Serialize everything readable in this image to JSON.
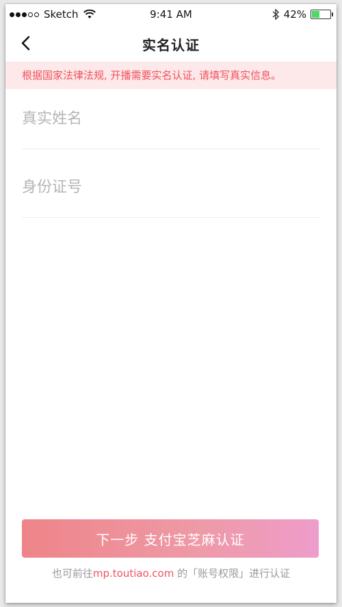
{
  "status_bar": {
    "carrier": "Sketch",
    "time": "9:41 AM",
    "battery_text": "42%",
    "battery_level": 0.42
  },
  "nav": {
    "title": "实名认证"
  },
  "notice": {
    "text": "根据国家法律法规, 开播需要实名认证, 请填写真实信息。"
  },
  "form": {
    "name_placeholder": "真实姓名",
    "id_placeholder": "身份证号"
  },
  "actions": {
    "next_label": "下一步 支付宝芝麻认证"
  },
  "footer": {
    "prefix": "也可前往",
    "link": "mp.toutiao.com",
    "suffix": " 的「账号权限」进行认证"
  },
  "colors": {
    "accent": "#f0525e",
    "notice_bg": "#fde9e9",
    "button_start": "#ee8489",
    "button_end": "#ee9ccb"
  }
}
